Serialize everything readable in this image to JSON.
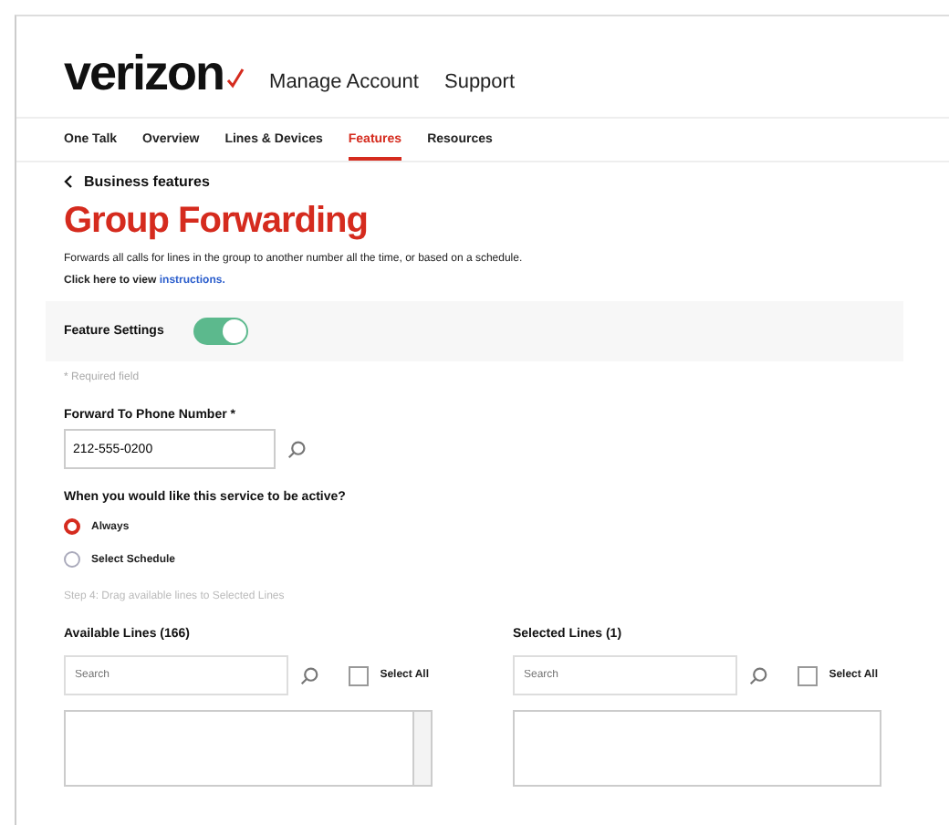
{
  "header": {
    "logo": "verizon",
    "nav": [
      "Manage Account",
      "Support"
    ]
  },
  "tabs": [
    {
      "label": "One Talk",
      "selected": false
    },
    {
      "label": "Overview",
      "selected": false
    },
    {
      "label": "Lines & Devices",
      "selected": false
    },
    {
      "label": "Features",
      "selected": true
    },
    {
      "label": "Resources",
      "selected": false
    }
  ],
  "breadcrumb": "Business features",
  "title": "Group Forwarding",
  "description": "Forwards all calls for lines in the group to another number all the time, or based on a schedule.",
  "instructions": {
    "text": "Click here to view",
    "link": "instructions."
  },
  "feature_settings": {
    "label": "Feature Settings",
    "on": true
  },
  "required_note": "* Required field",
  "forward": {
    "label": "Forward To Phone Number *",
    "value": "212-555-0200"
  },
  "schedule": {
    "question": "When you would like this service to be active?",
    "options": [
      {
        "label": "Always",
        "selected": true
      },
      {
        "label": "Select Schedule",
        "selected": false
      }
    ]
  },
  "hint": "Step 4: Drag available lines to Selected Lines",
  "lists": [
    {
      "heading": "Available Lines (166)",
      "placeholder": "Search",
      "select_all": "Select All",
      "checked": false,
      "scrollbar": true
    },
    {
      "heading": "Selected Lines (1)",
      "placeholder": "Search",
      "select_all": "Select All",
      "checked": false,
      "scrollbar": false
    }
  ]
}
